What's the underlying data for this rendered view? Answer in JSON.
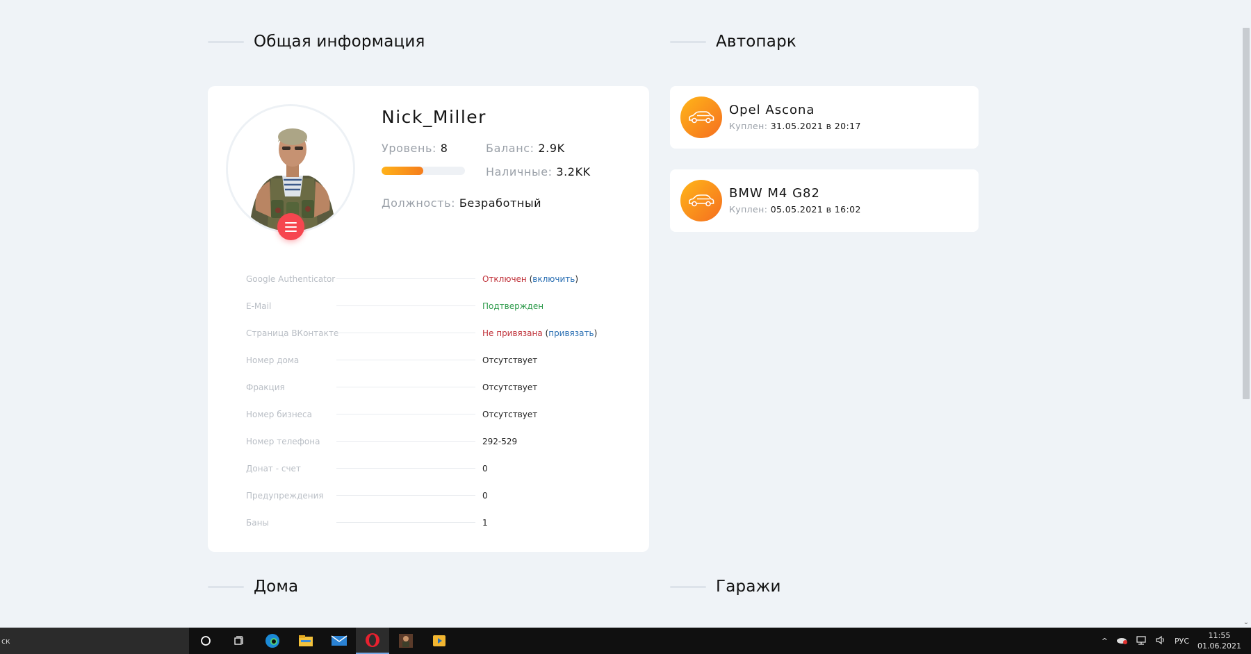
{
  "sections": {
    "general_info": "Общая информация",
    "autopark": "Автопарк",
    "houses": "Дома",
    "garages": "Гаражи"
  },
  "profile": {
    "nick": "Nick_Miller",
    "level_label": "Уровень:",
    "level_value": "8",
    "level_progress": 0.5,
    "balance_label": "Баланс:",
    "balance_value": "2.9K",
    "cash_label": "Наличные:",
    "cash_value": "3.2KK",
    "position_label": "Должность:",
    "position_value": "Безработный"
  },
  "info_rows": [
    {
      "key": "Google Authenticator",
      "value": "Отключен",
      "link": "включить",
      "status": "red"
    },
    {
      "key": "E-Mail",
      "value": "Подтвержден",
      "status": "green"
    },
    {
      "key": "Страница ВКонтакте",
      "value": "Не привязана",
      "link": "привязать",
      "status": "red"
    },
    {
      "key": "Номер дома",
      "value": "Отсутствует"
    },
    {
      "key": "Фракция",
      "value": "Отсутствует"
    },
    {
      "key": "Номер бизнеса",
      "value": "Отсутствует"
    },
    {
      "key": "Номер телефона",
      "value": "292-529"
    },
    {
      "key": "Донат - счет",
      "value": "0"
    },
    {
      "key": "Предупреждения",
      "value": "0"
    },
    {
      "key": "Баны",
      "value": "1"
    }
  ],
  "cars": [
    {
      "name": "Opel Ascona",
      "bought_label": "Куплен:",
      "bought_value": "31.05.2021 в 20:17",
      "icon": "car-icon"
    },
    {
      "name": "BMW M4 G82",
      "bought_label": "Куплен:",
      "bought_value": "05.05.2021 в 16:02",
      "icon": "car-icon"
    }
  ],
  "colors": {
    "accent_orange": "#f57d1c",
    "accent_red": "#f6464f",
    "status_red": "#c0323a",
    "status_green": "#2e9b4b",
    "link_blue": "#2a6fb3"
  },
  "taskbar": {
    "search_text": "ск",
    "apps": [
      "cortana-icon",
      "task-view-icon",
      "edge-icon",
      "file-explorer-icon",
      "mail-icon",
      "opera-icon",
      "game-icon",
      "media-player-icon"
    ],
    "language": "РУС",
    "time": "11:55",
    "date": "01.06.2021"
  }
}
